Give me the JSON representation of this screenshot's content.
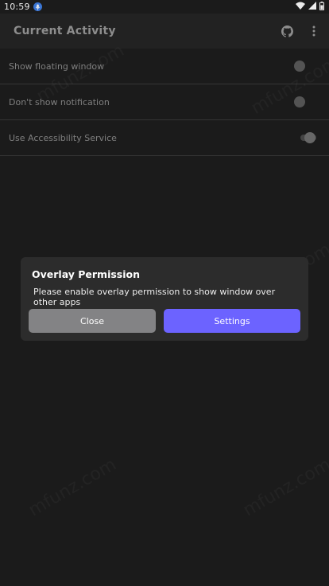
{
  "status_bar": {
    "time": "10:59",
    "icons": [
      "mic-icon",
      "wifi-icon",
      "signal-icon",
      "battery-icon"
    ]
  },
  "app_bar": {
    "title": "Current Activity",
    "actions": [
      "github-icon",
      "more-vert-icon"
    ]
  },
  "settings": [
    {
      "label": "Show floating window",
      "state": "off"
    },
    {
      "label": "Don't show notification",
      "state": "off"
    },
    {
      "label": "Use Accessibility Service",
      "state": "on"
    }
  ],
  "dialog": {
    "title": "Overlay Permission",
    "message": "Please enable overlay permission to show window over other apps",
    "close_label": "Close",
    "settings_label": "Settings"
  },
  "watermark": "mfunz.com",
  "colors": {
    "background": "#1e1e1e",
    "app_bar": "#252525",
    "dialog": "#2c2c2c",
    "accent": "#6c63ff",
    "close_button": "#838385"
  }
}
